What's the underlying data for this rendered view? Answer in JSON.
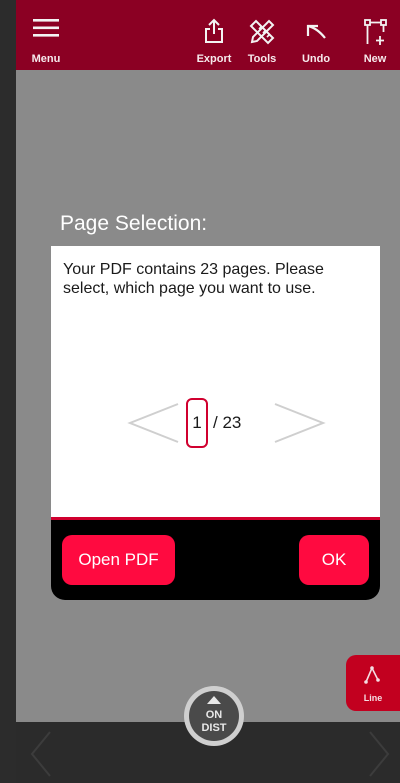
{
  "toolbar": {
    "menu_label": "Menu",
    "export_label": "Export",
    "tools_label": "Tools",
    "undo_label": "Undo",
    "new_label": "New"
  },
  "dialog": {
    "title": "Page Selection:",
    "message": "Your PDF contains 23 pages. Please select, which page you want to use.",
    "current_page": "1",
    "total_pages": "/ 23",
    "open_pdf_label": "Open PDF",
    "ok_label": "OK"
  },
  "line_tool": {
    "label": "Line"
  },
  "on_dist": {
    "top": "ON",
    "bottom": "DIST"
  },
  "colors": {
    "toolbar": "#8b0023",
    "accent": "#ff0a40",
    "border_accent": "#d0002f",
    "overlay": "#8a8a8a"
  }
}
